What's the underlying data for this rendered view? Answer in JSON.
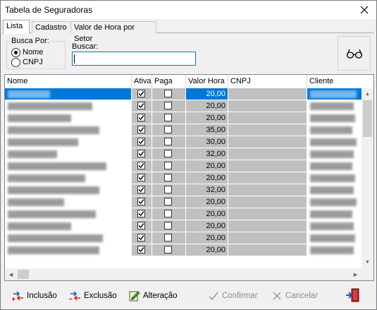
{
  "window": {
    "title": "Tabela de Seguradoras"
  },
  "tabs": [
    {
      "label": "Lista",
      "active": true
    },
    {
      "label": "Cadastro",
      "active": false
    },
    {
      "label": "Valor de Hora por Setor",
      "active": false
    }
  ],
  "search_by": {
    "legend": "Busca Por:",
    "options": [
      {
        "label": "Nome",
        "checked": true
      },
      {
        "label": "CNPJ",
        "checked": false
      }
    ]
  },
  "search": {
    "label": "Buscar:",
    "value": ""
  },
  "table": {
    "columns": [
      "Nome",
      "Ativa",
      "Paga ISS",
      "Valor Hora",
      "CNPJ",
      "Cliente"
    ],
    "rows": [
      {
        "ativa": true,
        "paga_iss": false,
        "valor_hora": "20,00",
        "selected": true
      },
      {
        "ativa": true,
        "paga_iss": false,
        "valor_hora": "20,00"
      },
      {
        "ativa": true,
        "paga_iss": false,
        "valor_hora": "20,00"
      },
      {
        "ativa": true,
        "paga_iss": false,
        "valor_hora": "35,00"
      },
      {
        "ativa": true,
        "paga_iss": false,
        "valor_hora": "30,00"
      },
      {
        "ativa": true,
        "paga_iss": false,
        "valor_hora": "32,00"
      },
      {
        "ativa": true,
        "paga_iss": false,
        "valor_hora": "20,00"
      },
      {
        "ativa": true,
        "paga_iss": false,
        "valor_hora": "20,00"
      },
      {
        "ativa": true,
        "paga_iss": false,
        "valor_hora": "32,00"
      },
      {
        "ativa": true,
        "paga_iss": false,
        "valor_hora": "20,00"
      },
      {
        "ativa": true,
        "paga_iss": false,
        "valor_hora": "20,00"
      },
      {
        "ativa": true,
        "paga_iss": false,
        "valor_hora": "20,00"
      },
      {
        "ativa": true,
        "paga_iss": false,
        "valor_hora": "20,00"
      },
      {
        "ativa": true,
        "paga_iss": false,
        "valor_hora": "20,00"
      }
    ]
  },
  "toolbar": {
    "inclusao": "Inclusão",
    "exclusao": "Exclusão",
    "alteracao": "Alteração",
    "confirmar": "Confirmar",
    "cancelar": "Cancelar"
  },
  "colors": {
    "selection": "#0078d7",
    "grid_cell": "#c0c0c0",
    "input_focus": "#0078d7"
  },
  "icons": [
    "close-icon",
    "glasses-icon",
    "add-record-icon",
    "delete-record-icon",
    "edit-record-icon",
    "check-icon",
    "cancel-icon",
    "exit-door-icon"
  ]
}
